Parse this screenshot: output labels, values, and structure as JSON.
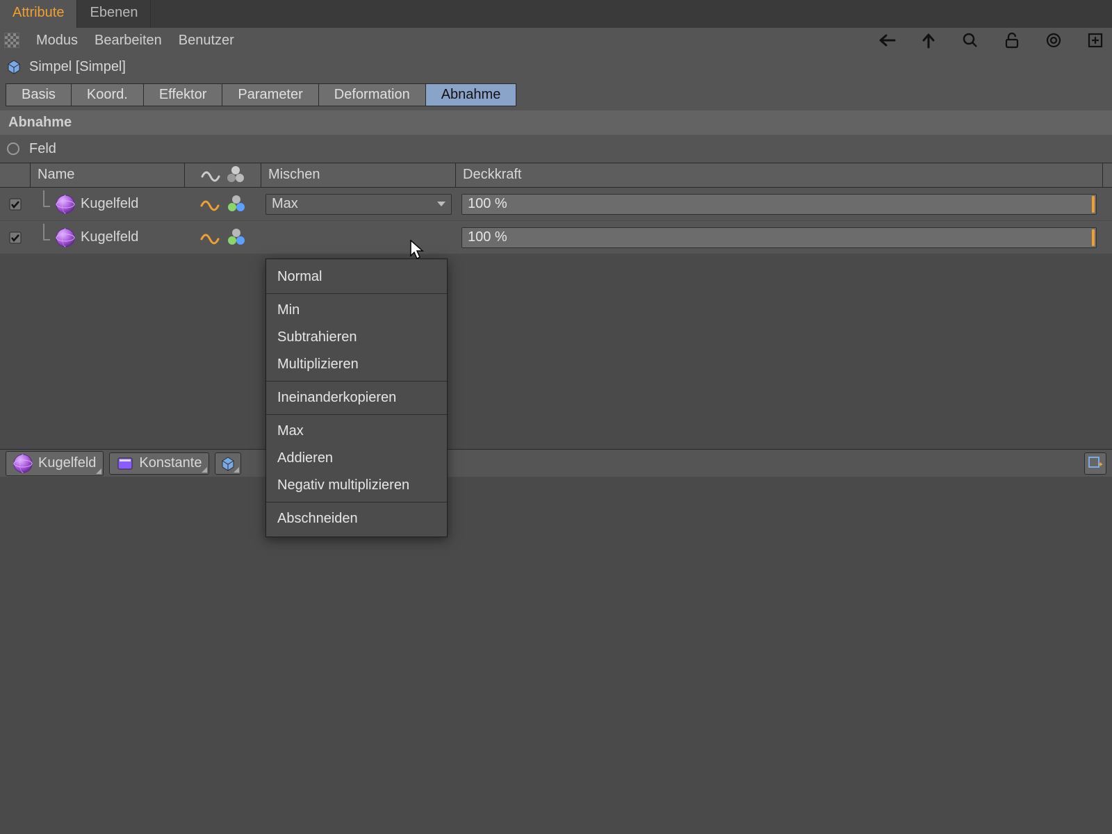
{
  "top_tabs": {
    "attribute": "Attribute",
    "layers": "Ebenen"
  },
  "menu": {
    "mode": "Modus",
    "edit": "Bearbeiten",
    "user": "Benutzer"
  },
  "object": {
    "title": "Simpel [Simpel]"
  },
  "sub_tabs": {
    "basis": "Basis",
    "koord": "Koord.",
    "effektor": "Effektor",
    "parameter": "Parameter",
    "deformation": "Deformation",
    "abnahme": "Abnahme"
  },
  "section": {
    "abnahme": "Abnahme",
    "feld": "Feld"
  },
  "columns": {
    "name": "Name",
    "mix": "Mischen",
    "opacity": "Deckkraft"
  },
  "rows": [
    {
      "name": "Kugelfeld",
      "mix": "Max",
      "opacity": "100 %"
    },
    {
      "name": "Kugelfeld",
      "mix": "",
      "opacity": "100 %"
    }
  ],
  "shelf": {
    "kugelfeld": "Kugelfeld",
    "konstante": "Konstante"
  },
  "popup": {
    "normal": "Normal",
    "min": "Min",
    "sub": "Subtrahieren",
    "mul": "Multiplizieren",
    "into": "Ineinanderkopieren",
    "max": "Max",
    "add": "Addieren",
    "negmul": "Negativ multiplizieren",
    "clip": "Abschneiden"
  },
  "colors": {
    "accent": "#f0a030",
    "tab_active": "#8aa3c8"
  }
}
